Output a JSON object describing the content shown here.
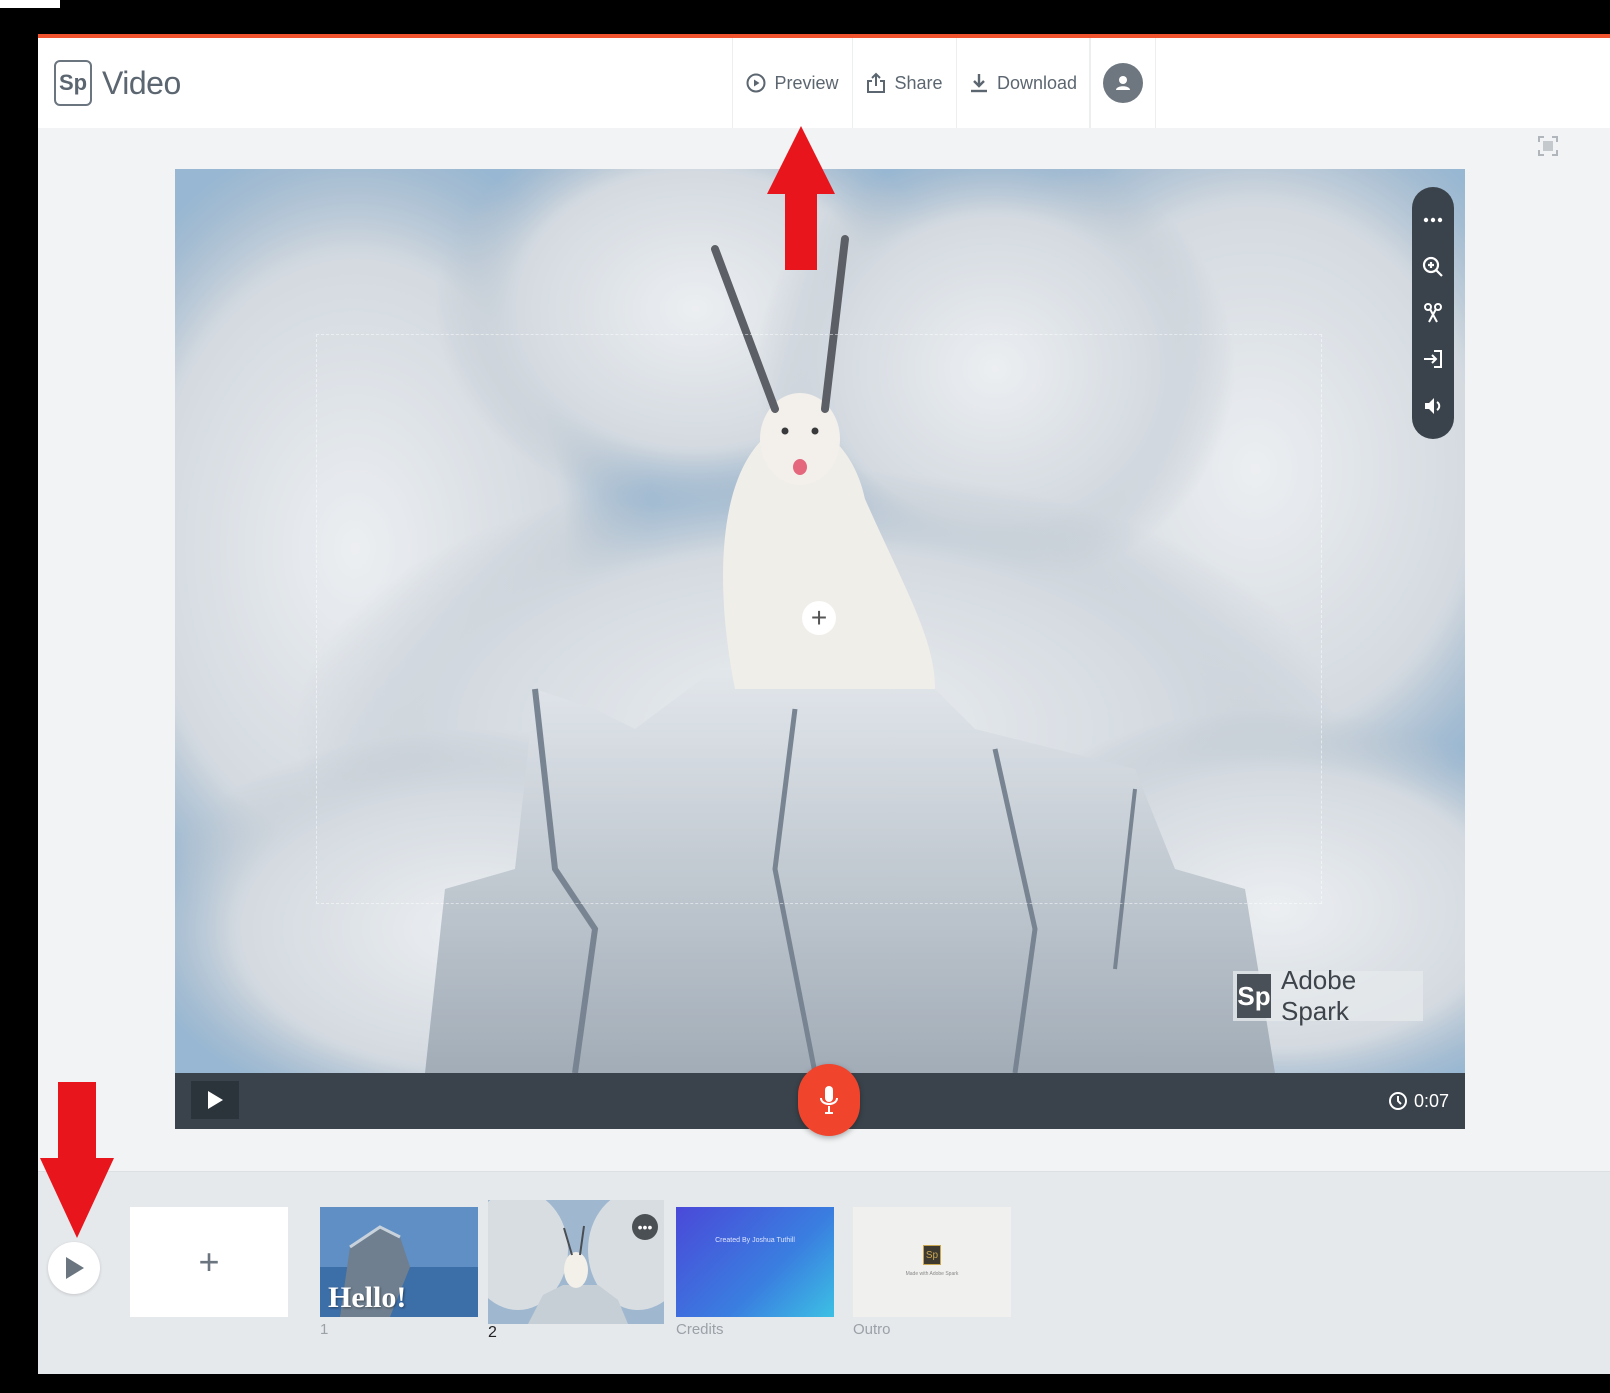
{
  "app": {
    "logo_mark": "Sp",
    "title": "Video"
  },
  "header": {
    "preview_label": "Preview",
    "share_label": "Share",
    "download_label": "Download"
  },
  "canvas": {
    "watermark_mark": "Sp",
    "watermark_text": "Adobe Spark",
    "duration": "0:07"
  },
  "side_tools": [
    "more-icon",
    "zoom-icon",
    "trim-icon",
    "insert-icon",
    "volume-icon"
  ],
  "timeline": {
    "slides": [
      {
        "title_text": "Hello!",
        "label": "1"
      },
      {
        "label": "2"
      },
      {
        "title_text": "Created By Joshua Tuthill",
        "label": "Credits"
      },
      {
        "icon_text": "Sp",
        "caption": "Made with Adobe Spark",
        "label": "Outro"
      }
    ]
  },
  "colors": {
    "accent": "#f0532d",
    "mic": "#f0442c",
    "arrow": "#e8151d",
    "playbar": "#3a434b"
  }
}
